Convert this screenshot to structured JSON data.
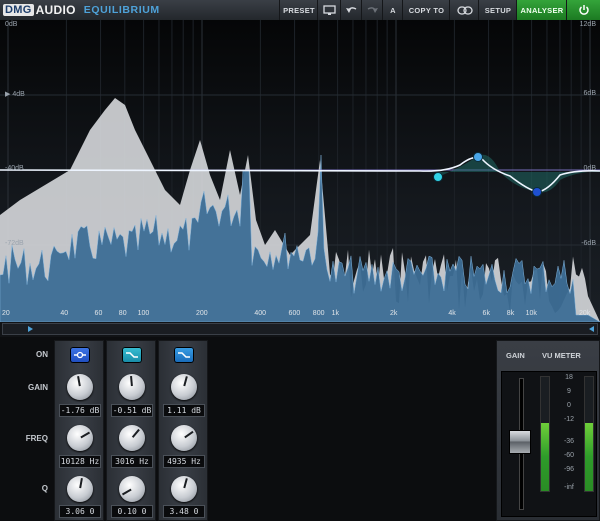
{
  "header": {
    "brand_dmg": "DMG",
    "brand_audio": "AUDIO",
    "product": "EQUILIBRIUM",
    "buttons": {
      "preset": "PRESET",
      "ab": "A",
      "copy_to": "COPY TO",
      "setup": "SETUP",
      "analyser": "ANALYSER"
    },
    "icons": [
      "monitor-icon",
      "undo-icon",
      "redo-icon",
      "link-icon",
      "power-icon"
    ],
    "accent_color": "#2a9a33"
  },
  "eq_display": {
    "left_scale": [
      "0dB",
      "4dB",
      "-40dB",
      "-72dB"
    ],
    "right_scale": [
      "12dB",
      "6dB",
      "0dB",
      "-6dB"
    ],
    "freq_labels": [
      "20",
      "40",
      "60",
      "80",
      "100",
      "200",
      "400",
      "600",
      "800",
      "1k",
      "2k",
      "4k",
      "6k",
      "8k",
      "10k",
      "20k"
    ],
    "curve_color": "#e8f1ff",
    "node_colors": [
      "#32d3e6",
      "#4aa6e8",
      "#1e4fd0"
    ]
  },
  "bands_panel": {
    "row_labels": {
      "on": "ON",
      "gain": "GAIN",
      "freq": "FREQ",
      "q": "Q"
    },
    "bands": [
      {
        "type_icon": "low-shelf-icon",
        "color": "#1e54c4",
        "gain": "-1.76 dB",
        "freq": "10128 Hz",
        "q": "3.06 0"
      },
      {
        "type_icon": "bell-icon",
        "color": "#1e9bb8",
        "gain": "-0.51 dB",
        "freq": "3016 Hz",
        "q": "0.10 0"
      },
      {
        "type_icon": "bell-icon",
        "color": "#1e7fd0",
        "gain": "1.11 dB",
        "freq": "4935 Hz",
        "q": "3.48 0"
      }
    ]
  },
  "meter": {
    "gain_label": "GAIN",
    "vu_label": "VU METER",
    "scale": [
      "18",
      "9",
      "0",
      "-12",
      "-36",
      "-60",
      "-96",
      "-inf"
    ],
    "level_fraction": 0.6
  }
}
